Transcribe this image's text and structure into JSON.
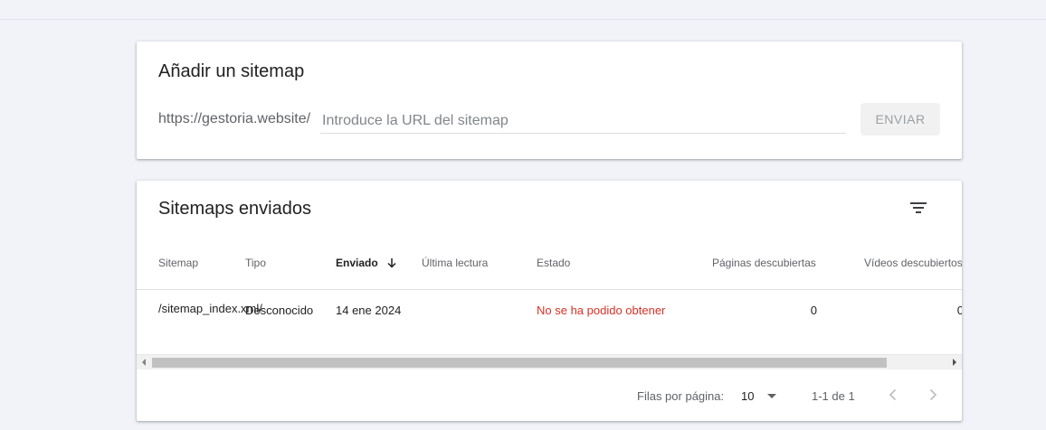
{
  "add_sitemap": {
    "title": "Añadir un sitemap",
    "url_prefix": "https://gestoria.website/",
    "input_value": "",
    "input_placeholder": "Introduce la URL del sitemap",
    "submit_label": "ENVIAR"
  },
  "sent_sitemaps": {
    "title": "Sitemaps enviados",
    "filter_icon": "filter-list-icon",
    "columns": {
      "sitemap": "Sitemap",
      "type": "Tipo",
      "submitted": "Enviado",
      "last_read": "Última lectura",
      "status": "Estado",
      "pages": "Páginas descubiertas",
      "videos": "Vídeos descubiertos"
    },
    "sort_icon": "arrow-down-icon",
    "rows": [
      {
        "sitemap": "/sitemap_index.xml/",
        "type": "Desconocido",
        "submitted": "14 ene 2024",
        "last_read": "",
        "status": "No se ha podido obtener",
        "pages": "0",
        "videos": "0"
      }
    ],
    "pagination": {
      "rows_per_page_label": "Filas por página:",
      "rows_per_page_value": "10",
      "range": "1-1 de 1",
      "prev_icon": "chevron-left-icon",
      "next_icon": "chevron-right-icon"
    }
  },
  "colors": {
    "background": "#f1f3f9",
    "error": "#d93025",
    "muted_text": "#5f6368"
  }
}
